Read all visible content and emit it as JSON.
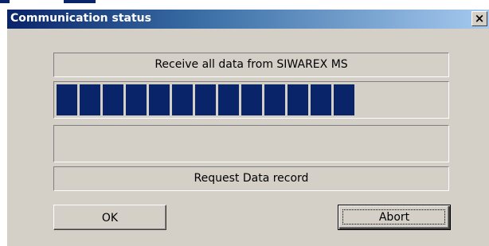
{
  "window": {
    "title": "Communication status",
    "close_label": "×"
  },
  "status": {
    "message": "Receive all data from SIWAREX MS",
    "request": "Request Data record"
  },
  "progress": {
    "filled_blocks": 13,
    "percent": 76,
    "color": "#0a246a"
  },
  "buttons": {
    "ok": "OK",
    "abort": "Abort"
  },
  "icons": {
    "close": "close-icon"
  }
}
